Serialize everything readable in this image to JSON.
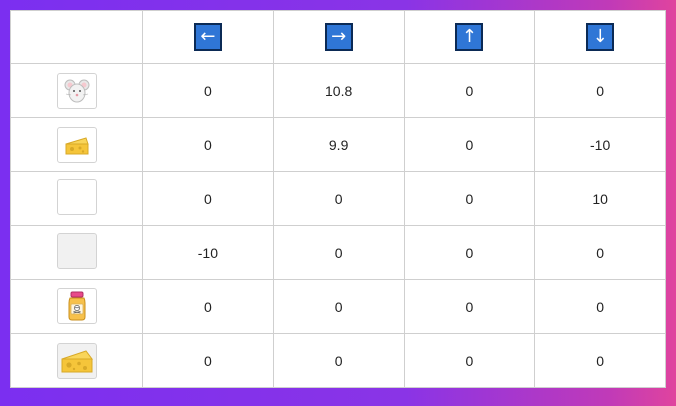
{
  "header": {
    "corner": "",
    "actions": [
      {
        "icon": "arrow-left-icon",
        "glyph": "←"
      },
      {
        "icon": "arrow-right-icon",
        "glyph": "→"
      },
      {
        "icon": "arrow-up-icon",
        "glyph": "↑"
      },
      {
        "icon": "arrow-down-icon",
        "glyph": "↓"
      }
    ]
  },
  "rows": [
    {
      "icon": "mouse-icon",
      "values": [
        "0",
        "10.8",
        "0",
        "0"
      ]
    },
    {
      "icon": "cheese-small-icon",
      "values": [
        "0",
        "9.9",
        "0",
        "-10"
      ]
    },
    {
      "icon": "empty-cell-icon",
      "values": [
        "0",
        "0",
        "0",
        "10"
      ]
    },
    {
      "icon": "empty-grey-cell-icon",
      "values": [
        "-10",
        "0",
        "0",
        "0"
      ]
    },
    {
      "icon": "poison-jar-icon",
      "values": [
        "0",
        "0",
        "0",
        "0"
      ]
    },
    {
      "icon": "cheese-large-icon",
      "values": [
        "0",
        "0",
        "0",
        "0"
      ]
    }
  ],
  "colors": {
    "arrow_button_fill": "#2f76d6",
    "arrow_button_border": "#0b2a55",
    "grid_line": "#cfcfcf",
    "background_left": "#7b2ff0",
    "background_right": "#e0449e"
  }
}
